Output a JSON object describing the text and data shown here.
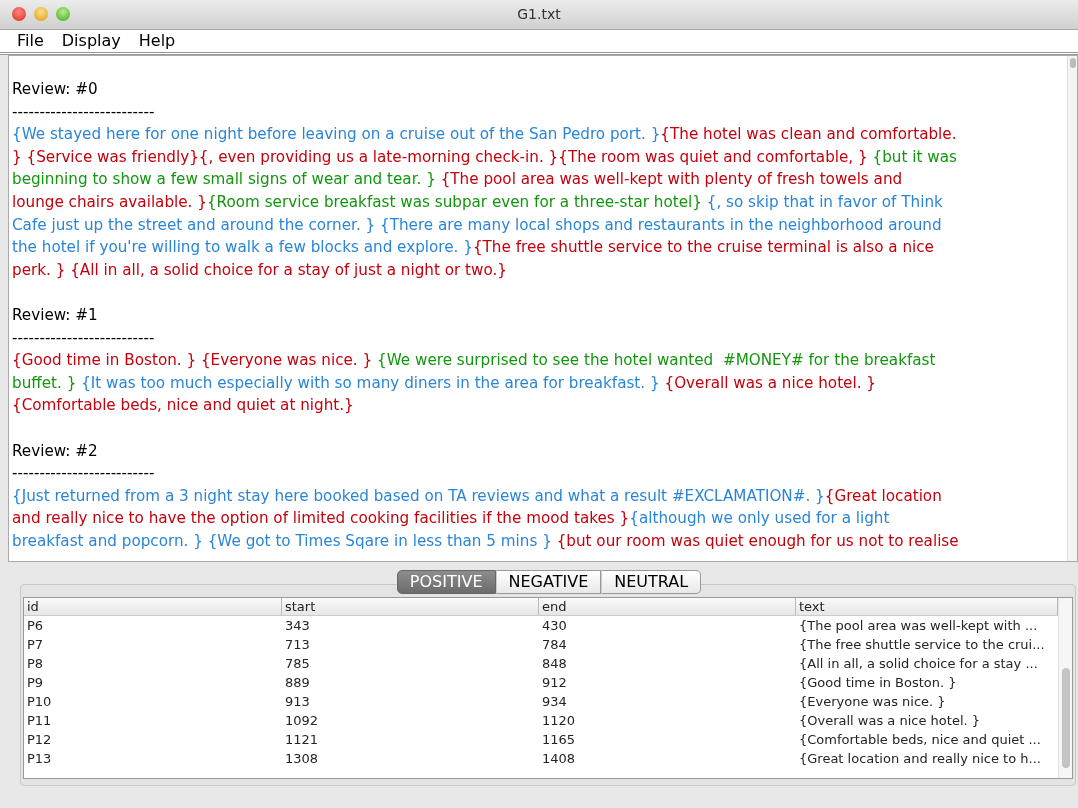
{
  "window": {
    "title": "G1.txt"
  },
  "menu": [
    "File",
    "Display",
    "Help"
  ],
  "reviews": [
    {
      "heading": "Review: #0",
      "rule": "--------------------------",
      "lines": [
        [
          {
            "text": "{We stayed here for one night before leaving on a cruise out of the San Pedro port. }",
            "color": "#2a85d8"
          },
          {
            "text": "{The hotel was clean and comfortable.",
            "color": "#c4000c"
          }
        ],
        [
          {
            "text": "} {Service was friendly}{, even providing us a late-morning check-in. }{The room was quiet and comfortable, } ",
            "color": "#c4000c"
          },
          {
            "text": "{but it was",
            "color": "#12960e"
          }
        ],
        [
          {
            "text": "beginning to show a few small signs of wear and tear. } ",
            "color": "#12960e"
          },
          {
            "text": "{The pool area was well-kept with plenty of fresh towels and",
            "color": "#c4000c"
          }
        ],
        [
          {
            "text": "lounge chairs available. }",
            "color": "#c4000c"
          },
          {
            "text": "{Room service breakfast was subpar even for a three-star hotel} ",
            "color": "#12960e"
          },
          {
            "text": "{, so skip that in favor of Think",
            "color": "#2a85d8"
          }
        ],
        [
          {
            "text": "Cafe just up the street and around the corner. } {There are many local shops and restaurants in the neighborhood around",
            "color": "#2a85d8"
          }
        ],
        [
          {
            "text": "the hotel if you're willing to walk a few blocks and explore. }",
            "color": "#2a85d8"
          },
          {
            "text": "{The free shuttle service to the cruise terminal is also a nice",
            "color": "#c4000c"
          }
        ],
        [
          {
            "text": "perk. } {All in all, a solid choice for a stay of just a night or two.}",
            "color": "#c4000c"
          }
        ]
      ]
    },
    {
      "heading": "Review: #1",
      "rule": "--------------------------",
      "lines": [
        [
          {
            "text": "{Good time in Boston. } {Everyone was nice. } ",
            "color": "#c4000c"
          },
          {
            "text": "{We were surprised to see the hotel wanted  #MONEY# for the breakfast",
            "color": "#12960e"
          }
        ],
        [
          {
            "text": "buffet. } ",
            "color": "#12960e"
          },
          {
            "text": "{It was too much especially with so many diners in the area for breakfast. } ",
            "color": "#2a85d8"
          },
          {
            "text": "{Overall was a nice hotel. }",
            "color": "#c4000c"
          }
        ],
        [
          {
            "text": "{Comfortable beds, nice and quiet at night.}",
            "color": "#c4000c"
          }
        ]
      ]
    },
    {
      "heading": "Review: #2",
      "rule": "--------------------------",
      "lines": [
        [
          {
            "text": "{Just returned from a 3 night stay here booked based on TA reviews and what a result #EXCLAMATION#. }",
            "color": "#2a85d8"
          },
          {
            "text": "{Great location",
            "color": "#c4000c"
          }
        ],
        [
          {
            "text": "and really nice to have the option of limited cooking facilities if the mood takes }",
            "color": "#c4000c"
          },
          {
            "text": "{although we only used for a light",
            "color": "#2a85d8"
          }
        ],
        [
          {
            "text": "breakfast and popcorn. } {We got to Times Sqare in less than 5 mins } ",
            "color": "#2a85d8"
          },
          {
            "text": "{but our room was quiet enough for us not to realise",
            "color": "#c4000c"
          }
        ]
      ]
    }
  ],
  "tabs": [
    {
      "label": "POSITIVE",
      "selected": true
    },
    {
      "label": "NEGATIVE",
      "selected": false
    },
    {
      "label": "NEUTRAL",
      "selected": false
    }
  ],
  "table": {
    "columns": [
      "id",
      "start",
      "end",
      "text"
    ],
    "rows": [
      [
        "P6",
        "343",
        "430",
        "{The pool area was well-kept with ..."
      ],
      [
        "P7",
        "713",
        "784",
        "{The free shuttle service to the crui..."
      ],
      [
        "P8",
        "785",
        "848",
        "{All in all, a solid choice for a stay ..."
      ],
      [
        "P9",
        "889",
        "912",
        "{Good time in Boston. }"
      ],
      [
        "P10",
        "913",
        "934",
        "{Everyone was nice. }"
      ],
      [
        "P11",
        "1092",
        "1120",
        "{Overall was a nice hotel. }"
      ],
      [
        "P12",
        "1121",
        "1165",
        "{Comfortable beds, nice and quiet ..."
      ],
      [
        "P13",
        "1308",
        "1408",
        "{Great location and really nice to h..."
      ]
    ]
  }
}
